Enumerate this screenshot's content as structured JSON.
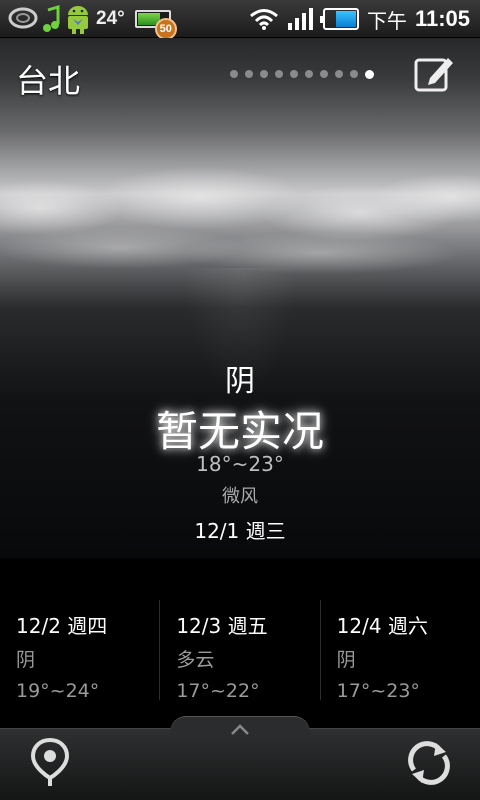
{
  "status_bar": {
    "temperature": "24°",
    "badge_count": "50",
    "ampm": "下午",
    "time": "11:05",
    "icons": [
      "notification-swirl-icon",
      "music-note-icon",
      "android-icon",
      "wifi-icon",
      "signal-icon",
      "battery-icon"
    ]
  },
  "header": {
    "city": "台北",
    "page_count": 10,
    "active_page": 10
  },
  "current": {
    "condition": "阴",
    "report": "暂无实况",
    "temp_range": "18°~23°",
    "wind": "微风",
    "date": "12/1 週三"
  },
  "forecast": [
    {
      "date": "12/2 週四",
      "condition": "阴",
      "temp_range": "19°~24°"
    },
    {
      "date": "12/3 週五",
      "condition": "多云",
      "temp_range": "17°~22°"
    },
    {
      "date": "12/4 週六",
      "condition": "阴",
      "temp_range": "17°~23°"
    }
  ],
  "bottom_bar": {
    "left_icon": "location-pin-icon",
    "right_icon": "refresh-icon",
    "handle_icon": "chevron-up-icon"
  }
}
